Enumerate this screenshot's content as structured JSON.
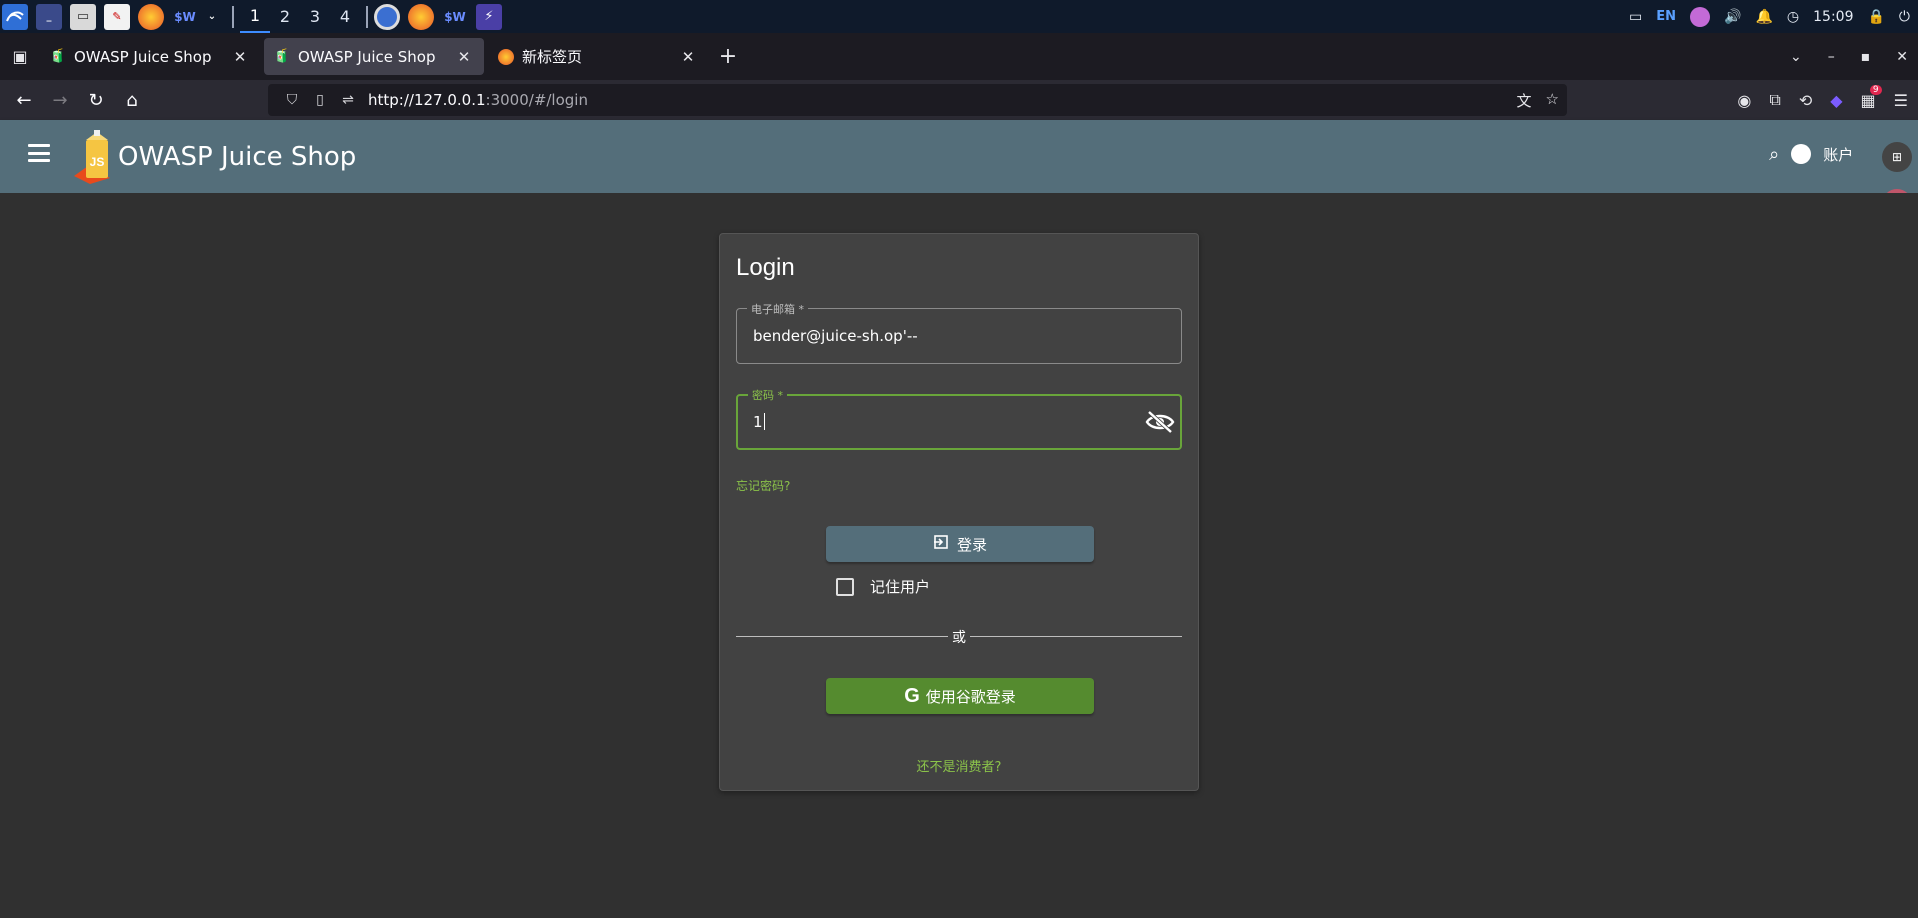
{
  "taskbar": {
    "apps": [
      "kali-menu-icon",
      "terminal-icon",
      "files-icon",
      "text-editor-icon",
      "firefox-icon",
      "shell-icon"
    ],
    "workspaces": [
      "1",
      "2",
      "3",
      "4"
    ],
    "active_workspace": "1",
    "tray": {
      "keyboard_layout": "EN",
      "time": "15:09"
    }
  },
  "browser": {
    "tabs": [
      {
        "title": "OWASP Juice Shop",
        "selected": false
      },
      {
        "title": "OWASP Juice Shop",
        "selected": true
      },
      {
        "title": "新标签页",
        "selected": false
      }
    ],
    "url_host": "http://127.0.0.1",
    "url_rest": ":3000/#/login",
    "extension_badge": "9"
  },
  "app": {
    "title": "OWASP Juice Shop",
    "account_label": "账户",
    "logo_text": "JS"
  },
  "login": {
    "title": "Login",
    "email_label": "电子邮箱 *",
    "email_value": "bender@juice-sh.op'--",
    "password_label": "密码 *",
    "password_value": "1",
    "forgot_password": "忘记密码?",
    "login_button": "登录",
    "remember_me": "记住用户",
    "or_text": "或",
    "google_button": "使用谷歌登录",
    "not_customer": "还不是消费者?"
  },
  "colors": {
    "header": "#546e7a",
    "accent_green": "#8bc34a",
    "google_button": "#558b2f",
    "card": "#424242",
    "background": "#303030"
  }
}
